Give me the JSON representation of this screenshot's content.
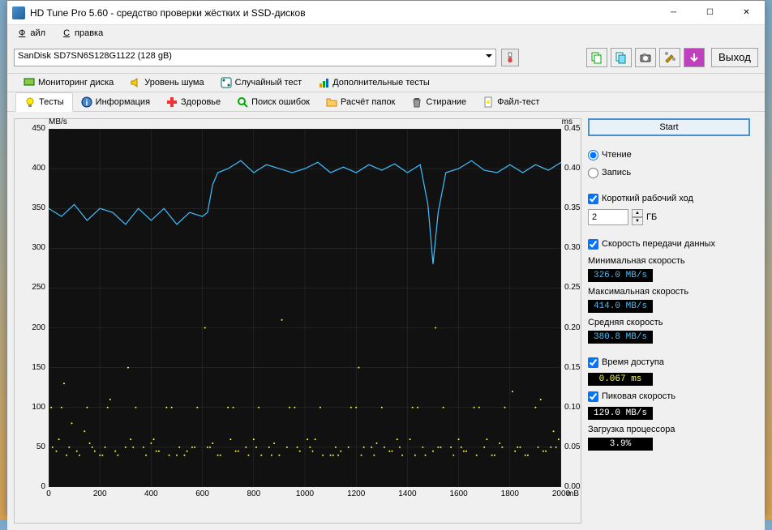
{
  "window": {
    "title": "HD Tune Pro 5.60 - средство проверки жёстких и SSD-дисков"
  },
  "menu": {
    "file": "Файл",
    "help": "Справка"
  },
  "toolbar": {
    "drive": "SanDisk SD7SN6S128G1122 (128 gB)",
    "exit": "Выход"
  },
  "tabs_top": [
    {
      "label": "Мониторинг диска"
    },
    {
      "label": "Уровень шума"
    },
    {
      "label": "Случайный тест"
    },
    {
      "label": "Дополнительные тесты"
    }
  ],
  "tabs_bottom": [
    {
      "label": "Тесты"
    },
    {
      "label": "Информация"
    },
    {
      "label": "Здоровье"
    },
    {
      "label": "Поиск ошибок"
    },
    {
      "label": "Расчёт папок"
    },
    {
      "label": "Стирание"
    },
    {
      "label": "Файл-тест"
    }
  ],
  "side": {
    "start": "Start",
    "read": "Чтение",
    "write": "Запись",
    "short_stroke": "Короткий рабочий ход",
    "gb_value": "2",
    "gb_unit": "ГБ",
    "transfer_rate": "Скорость передачи данных",
    "min_label": "Минимальная скорость",
    "min_val": "326.0 MB/s",
    "max_label": "Максимальная скорость",
    "max_val": "414.0 MB/s",
    "avg_label": "Средняя скорость",
    "avg_val": "380.8 MB/s",
    "access_time": "Время доступа",
    "access_val": "0.067 ms",
    "burst_label": "Пиковая скорость",
    "burst_val": "129.0 MB/s",
    "cpu_label": "Загрузка процессора",
    "cpu_val": "3.9%"
  },
  "chart_data": {
    "type": "line",
    "title": "",
    "xlabel": "mB",
    "ylabel_left": "MB/s",
    "ylabel_right": "ms",
    "xlim": [
      0,
      2000
    ],
    "ylim_left": [
      0,
      450
    ],
    "ylim_right": [
      0,
      0.45
    ],
    "xticks": [
      0,
      200,
      400,
      600,
      800,
      1000,
      1200,
      1400,
      1600,
      1800,
      2000
    ],
    "yticks_left": [
      0,
      50,
      100,
      150,
      200,
      250,
      300,
      350,
      400,
      450
    ],
    "yticks_right": [
      0,
      0.05,
      0.1,
      0.15,
      0.2,
      0.25,
      0.3,
      0.35,
      0.4,
      0.45
    ],
    "series": [
      {
        "name": "transfer_rate",
        "color": "#40c0ff",
        "axis": "left",
        "x": [
          0,
          50,
          100,
          150,
          200,
          250,
          300,
          350,
          400,
          450,
          500,
          550,
          600,
          620,
          640,
          660,
          700,
          750,
          800,
          850,
          900,
          950,
          1000,
          1050,
          1100,
          1150,
          1200,
          1250,
          1300,
          1350,
          1400,
          1450,
          1480,
          1500,
          1520,
          1550,
          1600,
          1650,
          1700,
          1750,
          1800,
          1850,
          1900,
          1950,
          2000
        ],
        "y": [
          350,
          340,
          355,
          335,
          350,
          345,
          330,
          350,
          335,
          350,
          330,
          345,
          340,
          345,
          380,
          395,
          400,
          410,
          395,
          405,
          400,
          395,
          400,
          408,
          395,
          402,
          395,
          405,
          398,
          406,
          395,
          405,
          355,
          280,
          345,
          395,
          400,
          410,
          398,
          395,
          405,
          395,
          405,
          398,
          408
        ]
      },
      {
        "name": "access_time",
        "color": "#ffff40",
        "axis": "right",
        "type": "scatter",
        "x": [
          10,
          30,
          50,
          80,
          120,
          150,
          180,
          200,
          230,
          260,
          300,
          340,
          380,
          420,
          460,
          500,
          540,
          580,
          620,
          660,
          700,
          740,
          780,
          820,
          860,
          900,
          940,
          980,
          1020,
          1060,
          1100,
          1140,
          1180,
          1220,
          1260,
          1300,
          1340,
          1380,
          1420,
          1460,
          1500,
          1540,
          1580,
          1620,
          1660,
          1700,
          1740,
          1780,
          1820,
          1860,
          1900,
          1940,
          1980,
          40,
          90,
          160,
          240,
          320,
          400,
          480,
          560,
          640,
          720,
          800,
          880,
          960,
          1040,
          1120,
          1200,
          1280,
          1360,
          1440,
          1520,
          1600,
          1680,
          1760,
          1840,
          1920,
          1990,
          60,
          140,
          220,
          310,
          410,
          510,
          610,
          710,
          810,
          910,
          1010,
          1110,
          1210,
          1310,
          1410,
          1510,
          1610,
          1710,
          1810,
          1910,
          1970,
          70,
          170,
          270,
          370,
          470,
          570,
          670,
          770,
          870,
          970,
          1070,
          1170,
          1270,
          1370,
          1470,
          1570,
          1670,
          1770,
          1870,
          1960,
          15,
          110,
          210,
          330,
          430,
          530,
          630,
          730,
          830,
          930,
          1030,
          1130,
          1230,
          1330,
          1430,
          1530,
          1630,
          1730,
          1830,
          1930
        ],
        "y": [
          0.1,
          0.045,
          0.1,
          0.05,
          0.04,
          0.1,
          0.045,
          0.04,
          0.1,
          0.045,
          0.05,
          0.1,
          0.04,
          0.045,
          0.1,
          0.04,
          0.045,
          0.1,
          0.05,
          0.04,
          0.1,
          0.045,
          0.04,
          0.1,
          0.05,
          0.04,
          0.1,
          0.045,
          0.05,
          0.1,
          0.04,
          0.045,
          0.1,
          0.04,
          0.05,
          0.1,
          0.045,
          0.04,
          0.1,
          0.05,
          0.045,
          0.1,
          0.04,
          0.045,
          0.1,
          0.05,
          0.04,
          0.1,
          0.045,
          0.04,
          0.1,
          0.045,
          0.05,
          0.06,
          0.08,
          0.055,
          0.11,
          0.06,
          0.055,
          0.1,
          0.05,
          0.055,
          0.1,
          0.06,
          0.055,
          0.1,
          0.06,
          0.05,
          0.1,
          0.055,
          0.06,
          0.1,
          0.05,
          0.06,
          0.1,
          0.055,
          0.05,
          0.11,
          0.06,
          0.13,
          0.07,
          0.05,
          0.15,
          0.06,
          0.05,
          0.2,
          0.06,
          0.05,
          0.21,
          0.06,
          0.04,
          0.15,
          0.05,
          0.06,
          0.2,
          0.05,
          0.06,
          0.12,
          0.05,
          0.07,
          0.04,
          0.05,
          0.04,
          0.05,
          0.04,
          0.05,
          0.04,
          0.05,
          0.04,
          0.05,
          0.04,
          0.05,
          0.04,
          0.05,
          0.04,
          0.05,
          0.04,
          0.05,
          0.04,
          0.05,
          0.05,
          0.045,
          0.04,
          0.05,
          0.045,
          0.04,
          0.05,
          0.045,
          0.04,
          0.05,
          0.045,
          0.04,
          0.05,
          0.045,
          0.04,
          0.05,
          0.045,
          0.04,
          0.05,
          0.045
        ]
      }
    ]
  }
}
